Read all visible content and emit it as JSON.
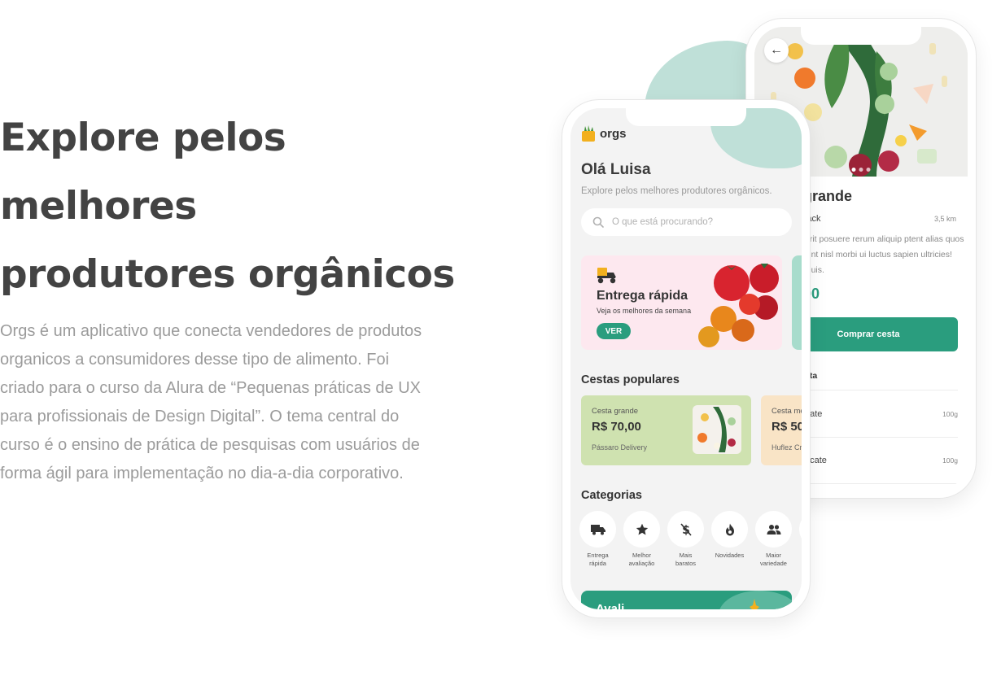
{
  "hero": {
    "title_line1": "Explore pelos melhores",
    "title_line2": "produtores orgânicos",
    "description": "Orgs é um aplicativo que conecta vendedores de produtos organicos a consumidores desse tipo de alimento. Foi criado para o curso da Alura de “Pequenas práticas de UX para profissionais de Design Digital”. O tema central do curso é o ensino de prática de pesquisas com usuários de forma ágil para implementação no dia-a-dia corporativo."
  },
  "details_screen": {
    "title": "grande",
    "seller": "lack",
    "distance": "3,5 km",
    "description": "erit posuere rerum aliquip ptent alias quos sint nisl morbi ui luctus sapien ultricies! Duis.",
    "price": "00",
    "buy_label": "Comprar cesta",
    "section_label": "sta",
    "items": [
      {
        "name": "nate",
        "qty": "100g"
      },
      {
        "name": "acate",
        "qty": "100g"
      }
    ]
  },
  "home_screen": {
    "logo": "orgs",
    "greeting": "Olá Luisa",
    "subtitle": "Explore pelos melhores produtores orgânicos.",
    "search_placeholder": "O que está procurando?",
    "banner": {
      "title": "Entrega rápida",
      "subtitle": "Veja os melhores da semana",
      "button": "VER"
    },
    "popular_title": "Cestas populares",
    "baskets": [
      {
        "name": "Cesta grande",
        "price": "R$ 70,00",
        "seller": "Pássaro Delivery"
      },
      {
        "name": "Cesta mé",
        "price": "R$ 50",
        "seller": "Huflez Cr"
      }
    ],
    "categories_title": "Categorias",
    "categories": [
      {
        "label_line1": "Entrega",
        "label_line2": "rápida",
        "icon": "truck-icon"
      },
      {
        "label_line1": "Melhor",
        "label_line2": "avaliação",
        "icon": "star-icon"
      },
      {
        "label_line1": "Mais",
        "label_line2": "baratos",
        "icon": "dollar-icon"
      },
      {
        "label_line1": "Novidades",
        "label_line2": "",
        "icon": "fire-icon"
      },
      {
        "label_line1": "Maior",
        "label_line2": "variedade",
        "icon": "people-icon"
      }
    ],
    "bottom_banner_text": "Avali"
  },
  "colors": {
    "primary": "#2a9d7e",
    "mint": "#bfe0d8",
    "banner_pink": "#fde8ef",
    "card_green": "#cfe2b0",
    "card_orange": "#f9e4c6"
  }
}
